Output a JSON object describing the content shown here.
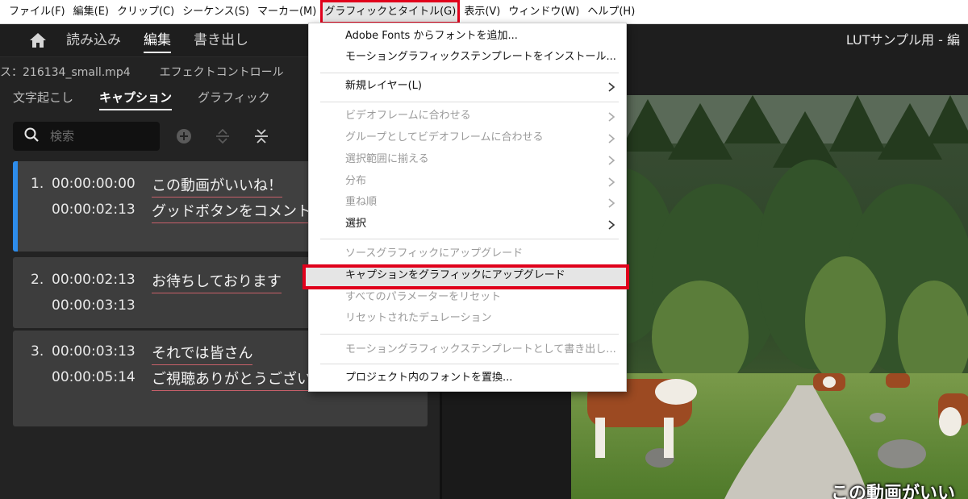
{
  "menubar": {
    "items": [
      {
        "label": "ファイル(F)"
      },
      {
        "label": "編集(E)"
      },
      {
        "label": "クリップ(C)"
      },
      {
        "label": "シーケンス(S)"
      },
      {
        "label": "マーカー(M)"
      },
      {
        "label": "グラフィックとタイトル(G)"
      },
      {
        "label": "表示(V)"
      },
      {
        "label": "ウィンドウ(W)"
      },
      {
        "label": "ヘルプ(H)"
      }
    ]
  },
  "workspace": {
    "tabs": [
      "読み込み",
      "編集",
      "書き出し"
    ],
    "active_tab": "編集",
    "project_title": "LUTサンプル用 - 編"
  },
  "panel": {
    "source_label": "ス：216134_small.mp4",
    "effect_controls_label": "エフェクトコントロール",
    "tabs": [
      "文字起こし",
      "キャプション",
      "グラフィック"
    ],
    "active_tab": "キャプション",
    "search_placeholder": "検索"
  },
  "captions": [
    {
      "num": "1.",
      "start": "00:00:00:00",
      "end": "00:00:02:13",
      "lines": [
        "この動画がいいね！",
        "グッドボタンをコメントも"
      ]
    },
    {
      "num": "2.",
      "start": "00:00:02:13",
      "end": "00:00:03:13",
      "lines": [
        "お待ちしております"
      ]
    },
    {
      "num": "3.",
      "start": "00:00:03:13",
      "end": "00:00:05:14",
      "lines": [
        "それでは皆さん",
        "ご視聴ありがとうございま"
      ]
    }
  ],
  "dropdown": {
    "items": [
      {
        "label": "Adobe Fonts からフォントを追加...",
        "disabled": false,
        "submenu": false
      },
      {
        "label": "モーショングラフィックステンプレートをインストール...",
        "disabled": false,
        "submenu": false
      },
      {
        "label": "新規レイヤー(L)",
        "disabled": false,
        "submenu": true
      },
      {
        "label": "ビデオフレームに合わせる",
        "disabled": true,
        "submenu": true
      },
      {
        "label": "グループとしてビデオフレームに合わせる",
        "disabled": true,
        "submenu": true
      },
      {
        "label": "選択範囲に揃える",
        "disabled": true,
        "submenu": true
      },
      {
        "label": "分布",
        "disabled": true,
        "submenu": true
      },
      {
        "label": "重ね順",
        "disabled": true,
        "submenu": true
      },
      {
        "label": "選択",
        "disabled": false,
        "submenu": true
      },
      {
        "label": "ソースグラフィックにアップグレード",
        "disabled": true,
        "submenu": false
      },
      {
        "label": "キャプションをグラフィックにアップグレード",
        "disabled": false,
        "submenu": false
      },
      {
        "label": "すべてのパラメーターをリセット",
        "disabled": true,
        "submenu": false
      },
      {
        "label": "リセットされたデュレーション",
        "disabled": true,
        "submenu": false
      },
      {
        "label": "モーショングラフィックステンプレートとして書き出し...",
        "disabled": true,
        "submenu": false
      },
      {
        "label": "プロジェクト内のフォントを置換...",
        "disabled": false,
        "submenu": false
      }
    ],
    "highlighted": "キャプションをグラフィックにアップグレード"
  },
  "preview": {
    "subtitle": "この動画がいい"
  },
  "colors": {
    "highlight_outline": "#e0001b",
    "selection_accent": "#2d8ceb",
    "panel_bg": "#232323",
    "card_bg": "#3d3d3d"
  }
}
